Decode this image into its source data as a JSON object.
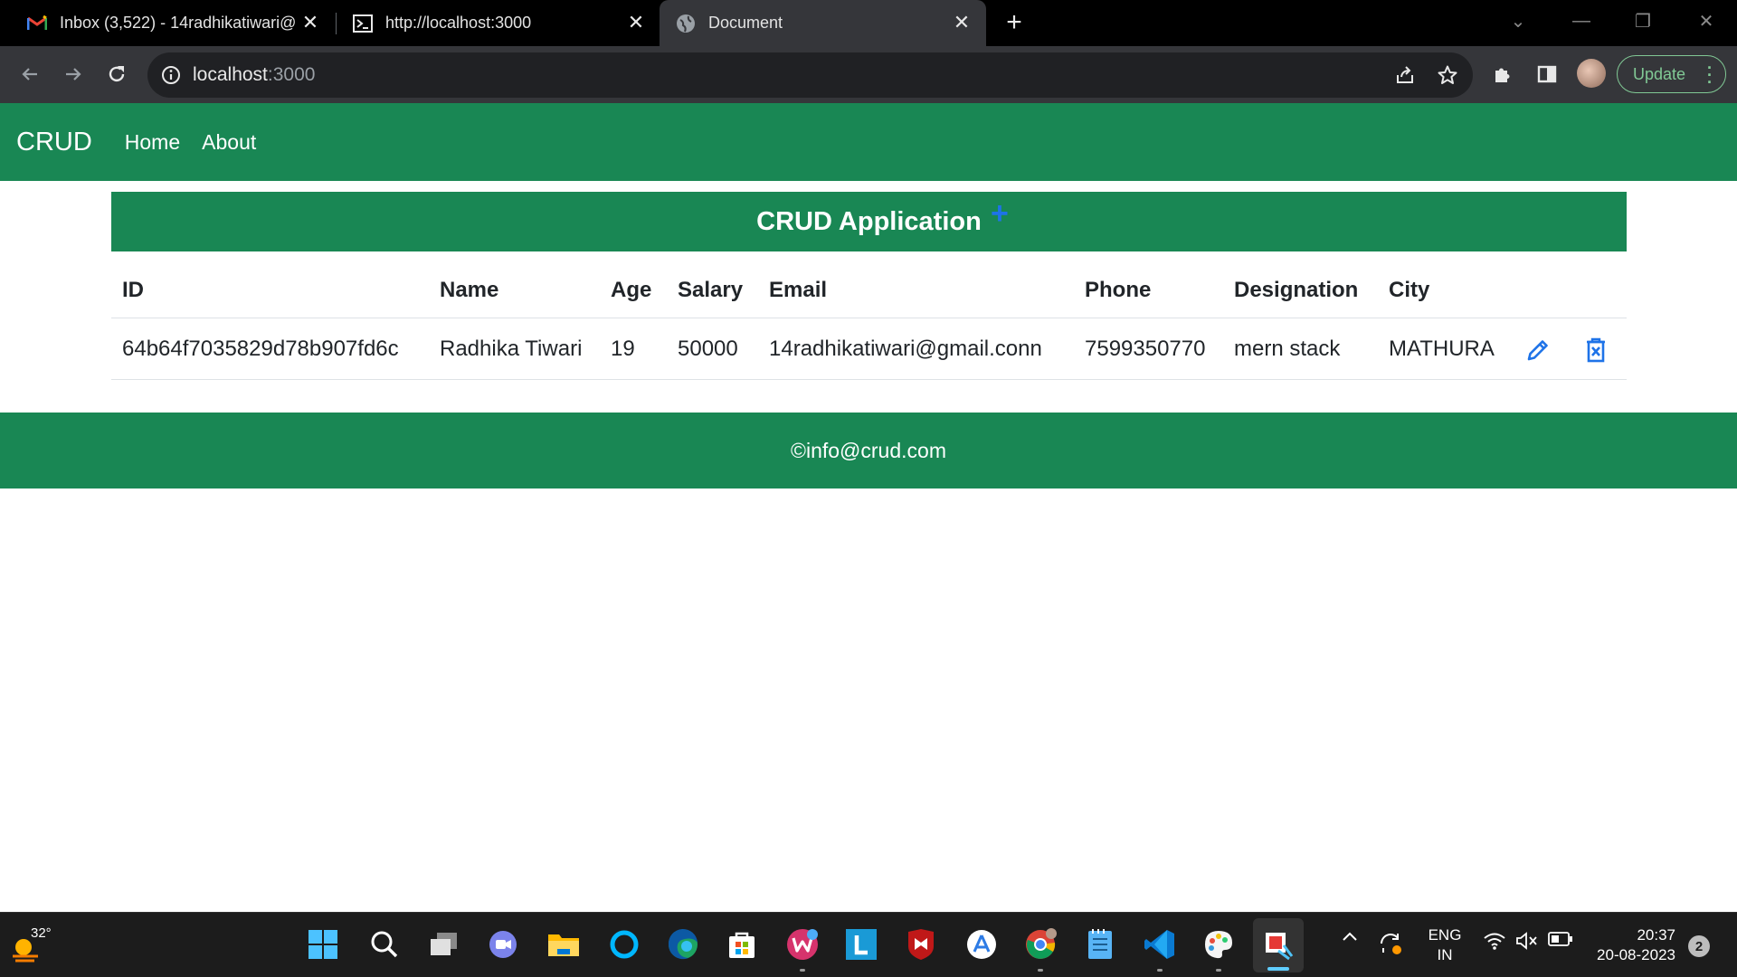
{
  "browser": {
    "tabs": [
      {
        "title": "Inbox (3,522) - 14radhikatiwari@",
        "icon": "gmail-icon"
      },
      {
        "title": "http://localhost:3000",
        "icon": "terminal-icon"
      },
      {
        "title": "Document",
        "icon": "globe-icon",
        "active": true
      }
    ],
    "url_host": "localhost",
    "url_port": ":3000",
    "update_label": "Update"
  },
  "nav": {
    "brand": "CRUD",
    "links": [
      "Home",
      "About"
    ]
  },
  "banner": {
    "title": "CRUD Application",
    "add_icon": "+"
  },
  "table": {
    "headers": [
      "ID",
      "Name",
      "Age",
      "Salary",
      "Email",
      "Phone",
      "Designation",
      "City"
    ],
    "rows": [
      {
        "id": "64b64f7035829d78b907fd6c",
        "name": "Radhika Tiwari",
        "age": "19",
        "salary": "50000",
        "email": "14radhikatiwari@gmail.conn",
        "phone": "7599350770",
        "designation": "mern stack",
        "city": "MATHURA"
      }
    ]
  },
  "footer": {
    "text": "©info@crud.com"
  },
  "taskbar": {
    "temperature": "32°",
    "lang_top": "ENG",
    "lang_bottom": "IN",
    "time": "20:37",
    "date": "20-08-2023",
    "notifications": "2"
  },
  "colors": {
    "primary_green": "#198754",
    "accent_blue": "#1e73e8",
    "chrome_dark": "#35363a"
  }
}
